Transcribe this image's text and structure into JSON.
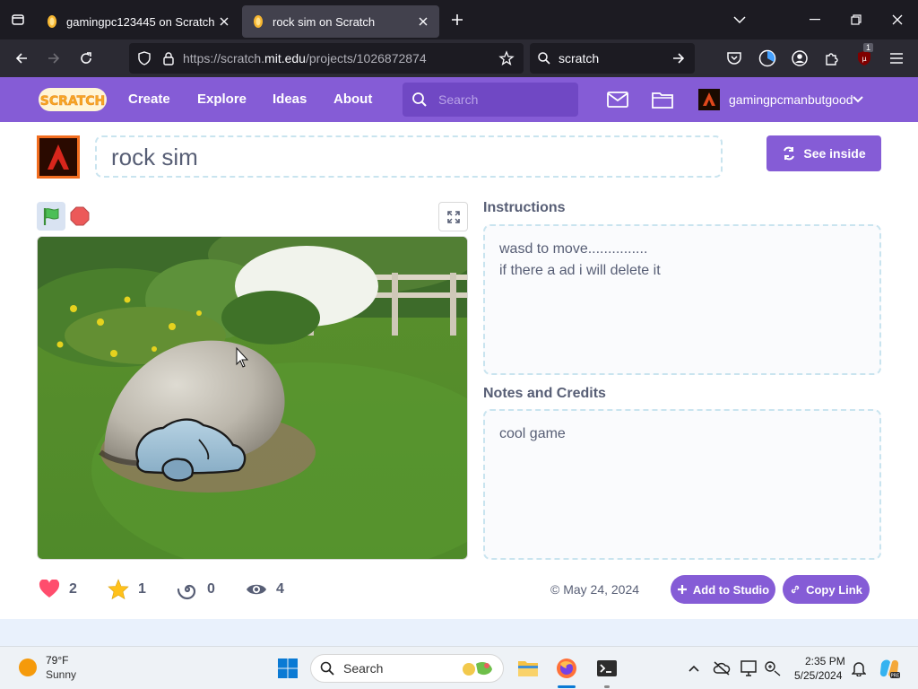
{
  "browser": {
    "tabs": [
      {
        "title": "gamingpc123445 on Scratch",
        "active": false
      },
      {
        "title": "rock sim on Scratch",
        "active": true
      }
    ],
    "url_host": "https://scratch.",
    "url_domain": "mit.edu",
    "url_path": "/projects/1026872874",
    "search_query": "scratch",
    "extension_badge": "1"
  },
  "scratch_nav": {
    "logo_text": "SCRATCH",
    "links": [
      "Create",
      "Explore",
      "Ideas",
      "About"
    ],
    "search_placeholder": "Search",
    "username": "gamingpcmanbutgood"
  },
  "project": {
    "title": "rock sim",
    "see_inside_label": "See inside",
    "instructions_label": "Instructions",
    "instructions_lines": [
      "wasd to move...............",
      "if there a ad i will delete it"
    ],
    "notes_label": "Notes and Credits",
    "notes_text": "cool game",
    "stats": {
      "loves": "2",
      "favorites": "1",
      "remixes": "0",
      "views": "4"
    },
    "date": "© May 24, 2024",
    "add_to_studio_label": "Add to Studio",
    "copy_link_label": "Copy Link"
  },
  "taskbar": {
    "weather_temp": "79°F",
    "weather_condition": "Sunny",
    "search_label": "Search",
    "time": "2:35 PM",
    "date": "5/25/2024"
  },
  "colors": {
    "scratch_purple": "#855cd6",
    "browser_dark": "#1c1b22",
    "text_gray": "#575e75"
  }
}
